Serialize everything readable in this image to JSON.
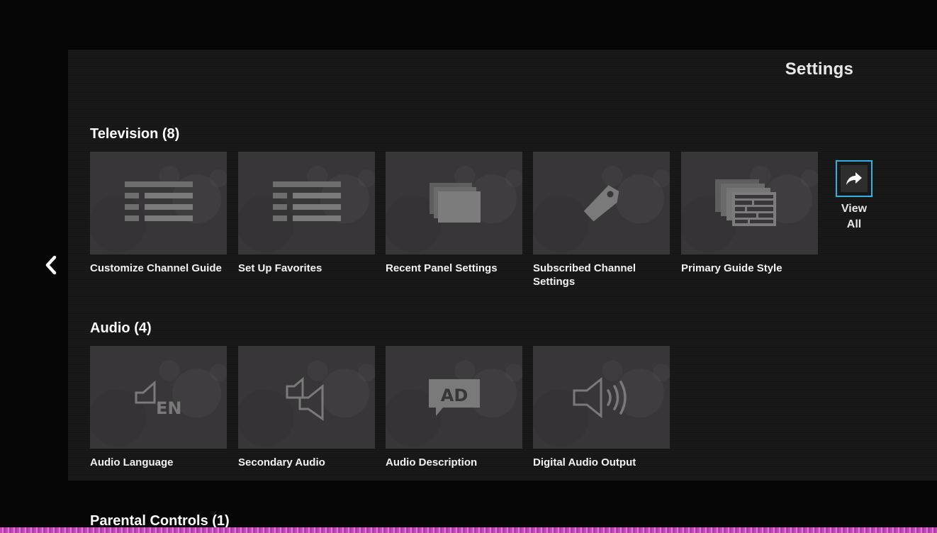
{
  "header": {
    "title": "Settings"
  },
  "nav": {
    "back_icon": "chevron-left-icon"
  },
  "sections": [
    {
      "title": "Television (8)",
      "tiles": [
        {
          "label": "Customize Channel Guide",
          "icon": "list-icon"
        },
        {
          "label": "Set Up Favorites",
          "icon": "list-icon"
        },
        {
          "label": "Recent Panel Settings",
          "icon": "stacked-panels-icon"
        },
        {
          "label": "Subscribed Channel Settings",
          "icon": "tag-icon"
        },
        {
          "label": "Primary Guide Style",
          "icon": "guide-grid-icon"
        }
      ],
      "view_all": {
        "line1": "View",
        "line2": "All",
        "icon": "share-arrow-icon"
      }
    },
    {
      "title": "Audio (4)",
      "tiles": [
        {
          "label": "Audio Language",
          "icon": "speaker-language-icon",
          "icon_text": "EN"
        },
        {
          "label": "Secondary Audio",
          "icon": "dual-speaker-icon"
        },
        {
          "label": "Audio Description",
          "icon": "audio-description-icon",
          "icon_text": "AD"
        },
        {
          "label": "Digital Audio Output",
          "icon": "speaker-waves-icon"
        }
      ]
    },
    {
      "title": "Parental Controls (1)"
    }
  ],
  "colors": {
    "focus": "#2bb3e6",
    "tile": "#383638",
    "icon": "#7a7a7a",
    "panel": "#161616"
  }
}
